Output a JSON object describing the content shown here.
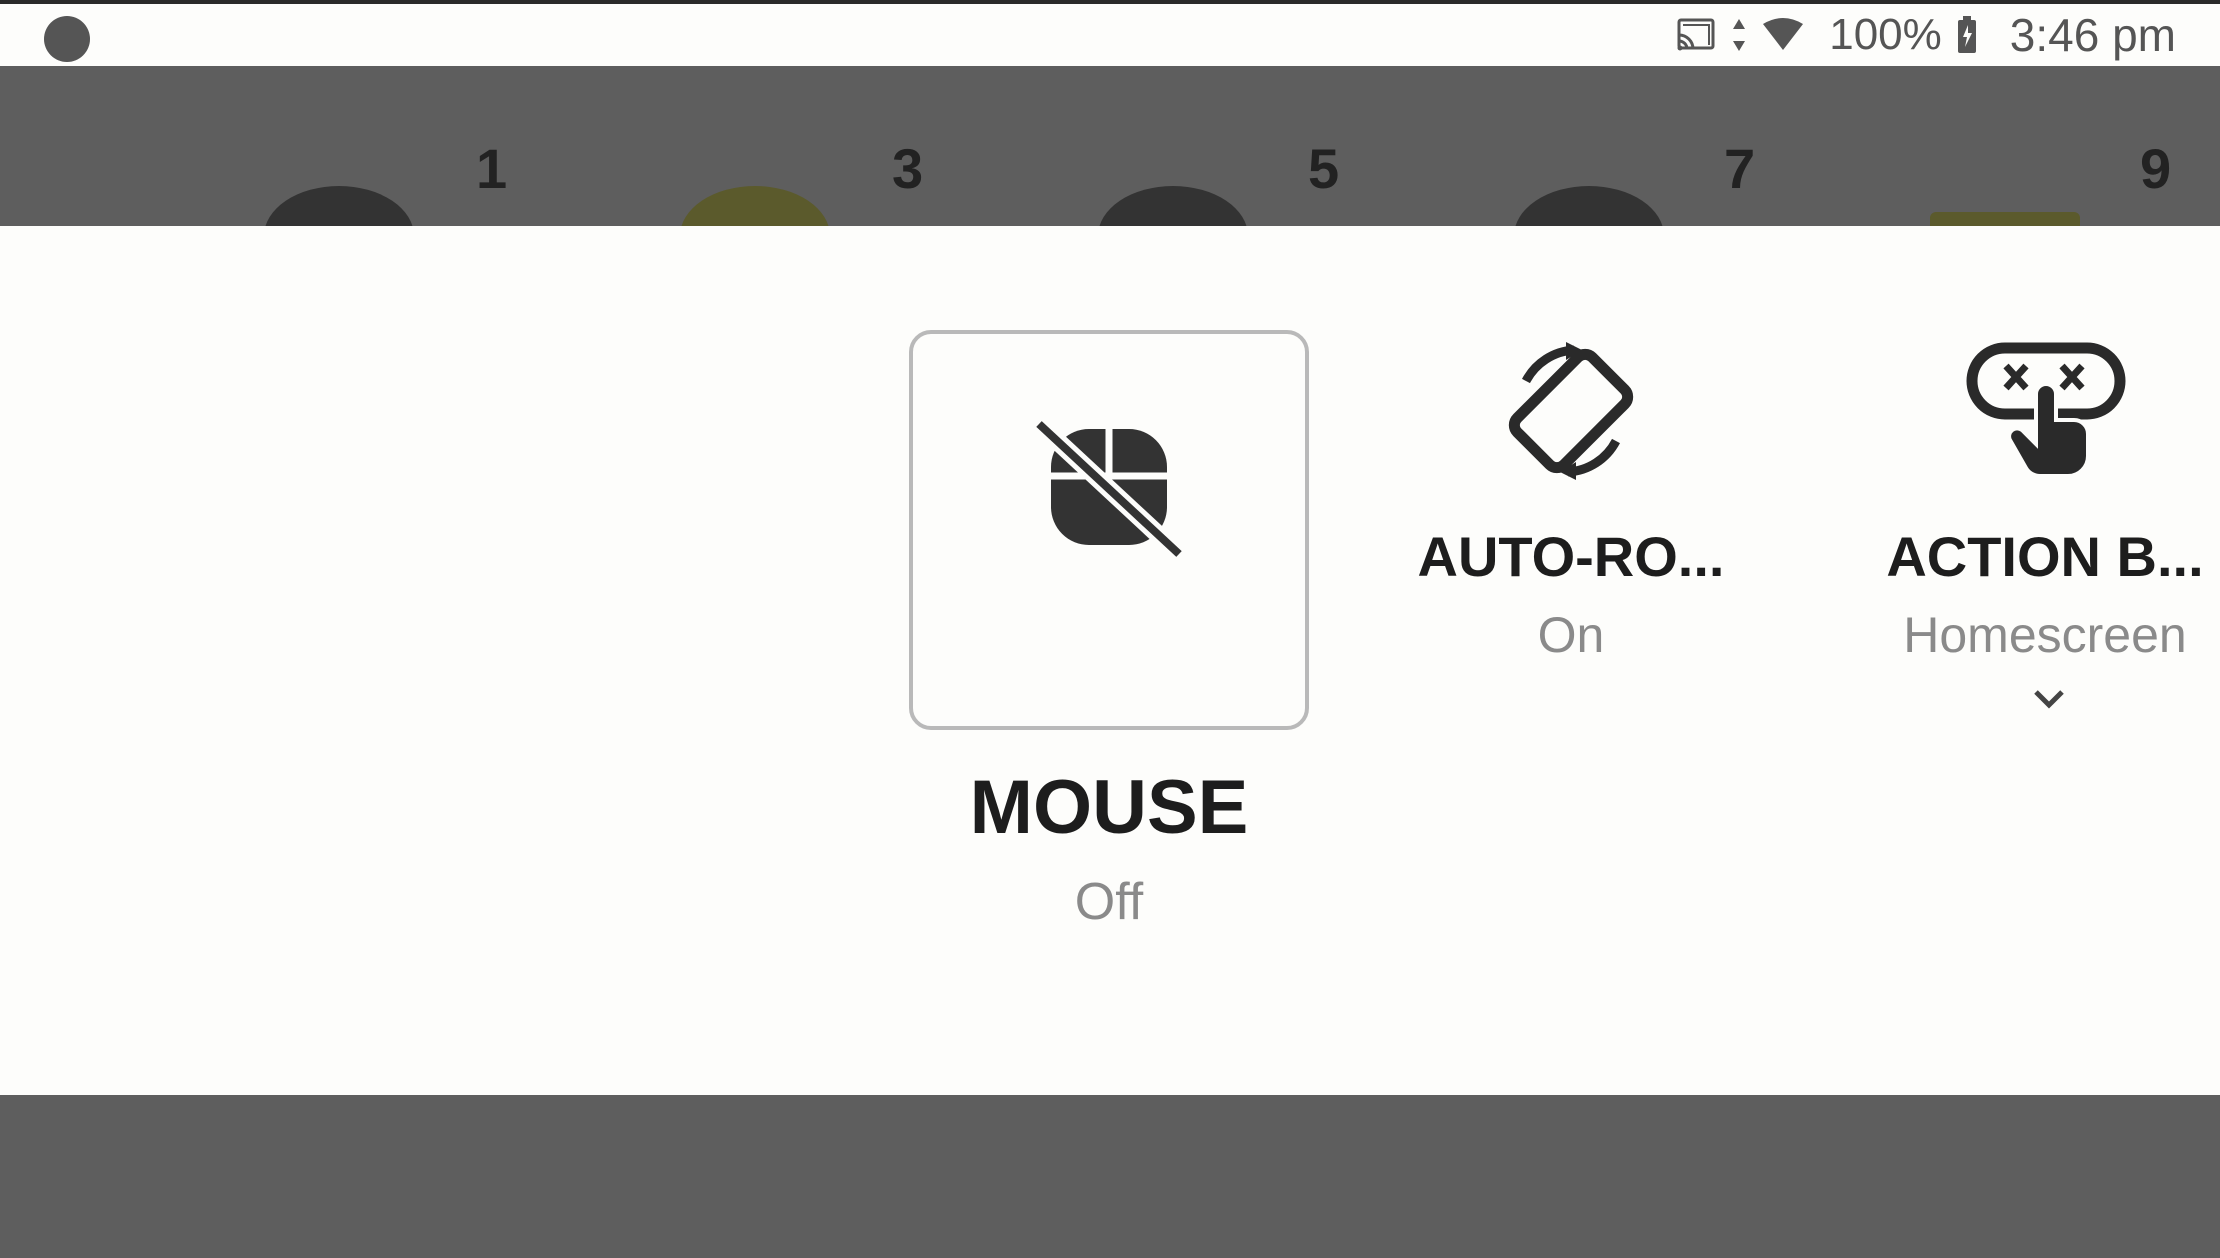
{
  "status_bar": {
    "battery_percent": "100%",
    "time": "3:46 pm",
    "icons": [
      "notification-dot-icon",
      "cast-icon",
      "data-arrows-icon",
      "wifi-icon",
      "battery-icon"
    ]
  },
  "background": {
    "numbers": [
      "1",
      "3",
      "5",
      "7",
      "9"
    ]
  },
  "tiles": {
    "mouse": {
      "label": "MOUSE",
      "state": "Off",
      "icon": "mouse-off-icon"
    },
    "auto_rotate": {
      "label": "AUTO-RO...",
      "state": "On",
      "icon": "auto-rotate-icon"
    },
    "action_button": {
      "label": "ACTION B...",
      "state": "Homescreen",
      "icon": "action-button-icon"
    }
  },
  "colors": {
    "panel_bg": "#fdfdfb",
    "dim_bg": "#5e5e5e",
    "text_primary": "#1d1d1d",
    "text_secondary": "#8a8a8a"
  }
}
